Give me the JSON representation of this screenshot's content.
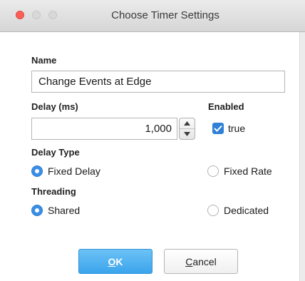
{
  "window": {
    "title": "Choose Timer Settings"
  },
  "form": {
    "name_label": "Name",
    "name_value": "Change Events at Edge",
    "delay_label": "Delay (ms)",
    "delay_value": "1,000",
    "enabled_label": "Enabled",
    "enabled_checked": true,
    "enabled_text": "true",
    "delay_type_label": "Delay Type",
    "delay_type_options": [
      {
        "label": "Fixed Delay",
        "selected": true
      },
      {
        "label": "Fixed Rate",
        "selected": false
      }
    ],
    "threading_label": "Threading",
    "threading_options": [
      {
        "label": "Shared",
        "selected": true
      },
      {
        "label": "Dedicated",
        "selected": false
      }
    ]
  },
  "buttons": {
    "ok_mnemonic": "O",
    "ok_rest": "K",
    "cancel_mnemonic": "C",
    "cancel_rest": "ancel"
  },
  "colors": {
    "accent": "#3a8ee6",
    "close_light": "#fc5f57"
  }
}
